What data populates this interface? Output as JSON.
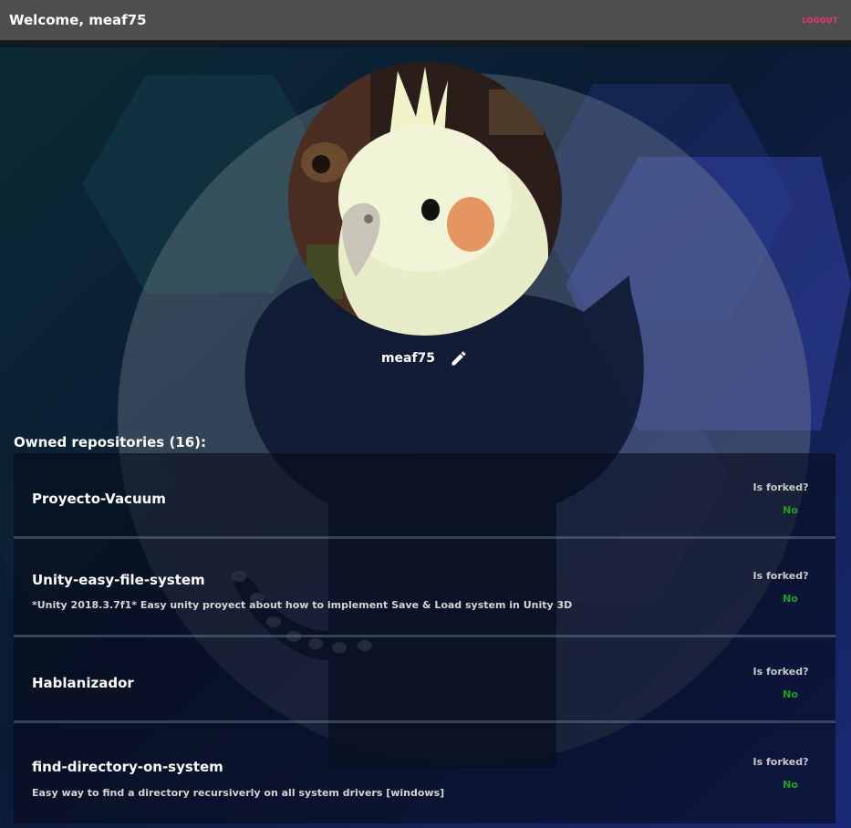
{
  "header": {
    "welcome": "Welcome, meaf75",
    "logout": "LOGOUT"
  },
  "profile": {
    "username": "meaf75",
    "avatar_icon": "cockatiel-avatar",
    "edit_icon": "pencil-icon"
  },
  "repos": {
    "title": "Owned repositories (16):",
    "forked_label": "Is forked?",
    "items": [
      {
        "name": "Proyecto-Vacuum",
        "description": "",
        "forked": "No"
      },
      {
        "name": "Unity-easy-file-system",
        "description": "*Unity 2018.3.7f1* Easy unity proyect about how to implement Save & Load system in Unity 3D",
        "forked": "No"
      },
      {
        "name": "Hablanizador",
        "description": "",
        "forked": "No"
      },
      {
        "name": "find-directory-on-system",
        "description": "Easy way to find a directory recursiverly on all system drivers [windows]",
        "forked": "No"
      }
    ]
  },
  "colors": {
    "header_bg": "#4e4e4e",
    "logout": "#ff2f73",
    "forked_no": "#1fa11f",
    "background": "#0b1a26"
  }
}
